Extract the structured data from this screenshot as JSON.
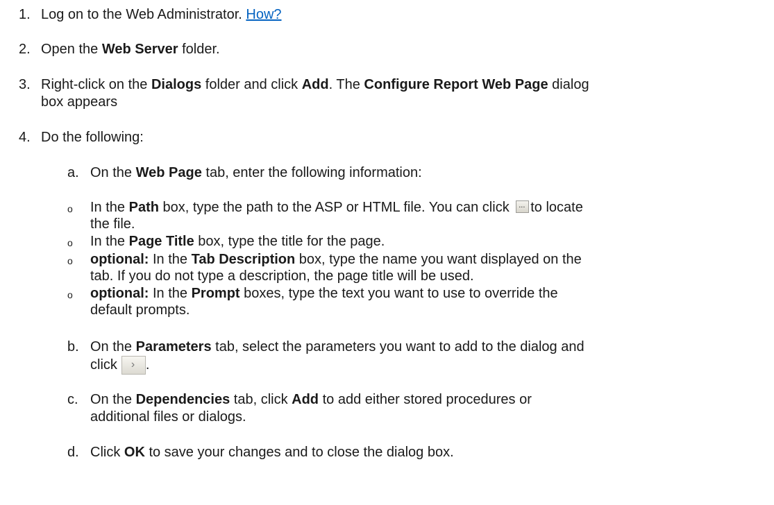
{
  "steps": [
    {
      "num": "1.",
      "text": "Log on to the Web Administrator. ",
      "link": "How?"
    },
    {
      "num": "2.",
      "pre": "Open the ",
      "bold": "Web Server",
      "post": " folder."
    },
    {
      "num": "3.",
      "pre": "Right-click on the ",
      "bold1": "Dialogs",
      "mid1": " folder and click ",
      "bold2": "Add",
      "mid2": ". The ",
      "bold3": "Configure Report Web Page",
      "post": " dialog",
      "cont": "box appears"
    },
    {
      "num": "4.",
      "text": "Do the following:"
    }
  ],
  "substeps": {
    "a": {
      "letter": "a.",
      "pre": "On the ",
      "bold": "Web Page",
      "post": " tab, enter the following information:"
    },
    "b": {
      "letter": "b.",
      "pre": "On the ",
      "bold": "Parameters",
      "post": " tab, select the parameters you want to add to the dialog and",
      "cont": "click"
    },
    "c": {
      "letter": "c.",
      "pre": "On the ",
      "bold": "Dependencies",
      "mid": " tab, click ",
      "bold2": "Add",
      "post": " to add either stored procedures or",
      "cont": "additional files or dialogs."
    },
    "d": {
      "letter": "d.",
      "pre": "Click ",
      "bold": "OK",
      "post": " to save your changes and to close the dialog box."
    }
  },
  "bullets": [
    {
      "pre": "In the ",
      "bold": "Path",
      "post": " box, type the path to the ASP or HTML file. You can click ",
      "after": "to locate",
      "cont": "the file."
    },
    {
      "pre": "In the ",
      "bold": "Page Title",
      "post": " box, type the title for the page."
    },
    {
      "label": "optional:",
      "pre": " In the ",
      "bold": "Tab Description",
      "post": " box, type the name you want displayed on the",
      "cont": "tab. If you do not type a description, the page title will be used."
    },
    {
      "label": "optional:",
      "pre": " In the ",
      "bold": "Prompt",
      "post": " boxes, type the text you want to use to override the",
      "cont": "default prompts."
    }
  ],
  "bullet_glyph": "o",
  "icons": {
    "browse": "ellipsis-button-icon",
    "add": "add-arrow-button-icon"
  },
  "link_color": "#0563c1"
}
